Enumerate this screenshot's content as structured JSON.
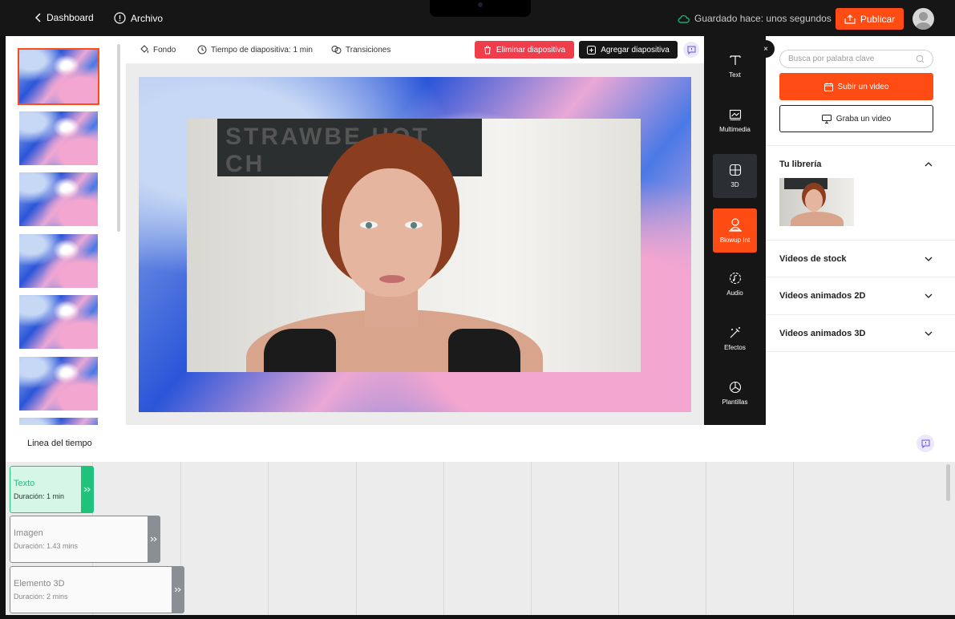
{
  "topbar": {
    "back_label": "Dashboard",
    "file_label": "Archivo",
    "saved_status": "Guardado hace: unos segundos",
    "publish_label": "Publicar"
  },
  "toolbar": {
    "background_label": "Fondo",
    "slide_time_label": "Tiempo de diapositiva: 1 min",
    "transitions_label": "Transiciones",
    "delete_slide_label": "Eliminar diapositiva",
    "add_slide_label": "Agregar diapositiva"
  },
  "thumbnails": {
    "count": 7,
    "active_index": 0
  },
  "rail": {
    "close_label": "×",
    "items": [
      {
        "label": "Text",
        "icon": "text-icon"
      },
      {
        "label": "Multimedia",
        "icon": "multimedia-icon"
      },
      {
        "label": "3D",
        "icon": "cube-icon",
        "state": "highlighted"
      },
      {
        "label": "Blowup Int",
        "icon": "blowup-icon",
        "state": "active"
      },
      {
        "label": "Audio",
        "icon": "audio-icon"
      },
      {
        "label": "Efectos",
        "icon": "effects-icon"
      },
      {
        "label": "Plantillas",
        "icon": "templates-icon"
      }
    ]
  },
  "panel": {
    "search_placeholder": "Busca por palabra clave",
    "upload_label": "Subir un video",
    "record_label": "Graba un video",
    "sections": [
      {
        "title": "Tu librería",
        "expanded": true
      },
      {
        "title": "Videos de stock",
        "expanded": false
      },
      {
        "title": "Videos animados 2D",
        "expanded": false
      },
      {
        "title": "Videos animados 3D",
        "expanded": false
      }
    ]
  },
  "slide": {
    "sign_text": "STRAWBE HOT CH"
  },
  "timeline": {
    "title": "Linea del tiempo",
    "clips": [
      {
        "name": "Texto",
        "duration": "Duración: 1 min"
      },
      {
        "name": "Imagen",
        "duration": "Duración: 1.43 mins"
      },
      {
        "name": "Elemento 3D",
        "duration": "Duración: 2 mins"
      }
    ]
  },
  "colors": {
    "accent": "#ff4b14",
    "danger": "#ef3d4b",
    "dark": "#161616",
    "timeline_text": "#1ec27a"
  }
}
